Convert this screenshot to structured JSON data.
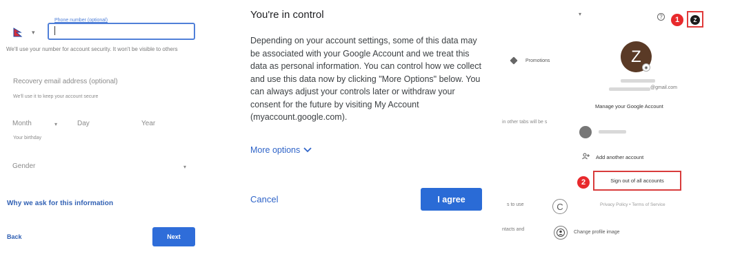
{
  "left": {
    "phone_label": "Phone number (optional)",
    "phone_hint": "We'll use your number for account security. It won't be visible to others",
    "recovery_placeholder": "Recovery email address (optional)",
    "recovery_hint": "We'll use it to keep your account secure",
    "month_placeholder": "Month",
    "day_placeholder": "Day",
    "year_placeholder": "Year",
    "birthday_hint": "Your birthday",
    "gender_placeholder": "Gender",
    "why_link": "Why we ask for this information",
    "back_label": "Back",
    "next_label": "Next"
  },
  "middle": {
    "title": "You're in control",
    "body": "Depending on your account settings, some of this data may be associated with your Google Account and we treat this data as personal information. You can control how we collect and use this data now by clicking \"More Options\" below. You can always adjust your controls later or withdraw your consent for the future by visiting My Account (myaccount.google.com).",
    "more_options": "More options",
    "cancel_label": "Cancel",
    "agree_label": "I agree"
  },
  "right": {
    "badge_1": "1",
    "badge_2": "2",
    "avatar_letter": "Z",
    "promotions_label": "Promotions",
    "email_suffix": "@gmail.com",
    "manage_account": "Manage your Google Account",
    "tabs_text": "in other tabs will be s",
    "add_account": "Add another account",
    "sign_out_all": "Sign out of all accounts",
    "to_use_text": "s to use",
    "privacy_terms": "Privacy Policy  •  Terms of Service",
    "contacts_text": "ntacts and",
    "change_profile": "Change profile image"
  },
  "colors": {
    "accent_blue": "#2a6bd6",
    "link_blue": "#2f64c8",
    "highlight_red": "#e8292c",
    "avatar_brown": "#5a3a26"
  }
}
